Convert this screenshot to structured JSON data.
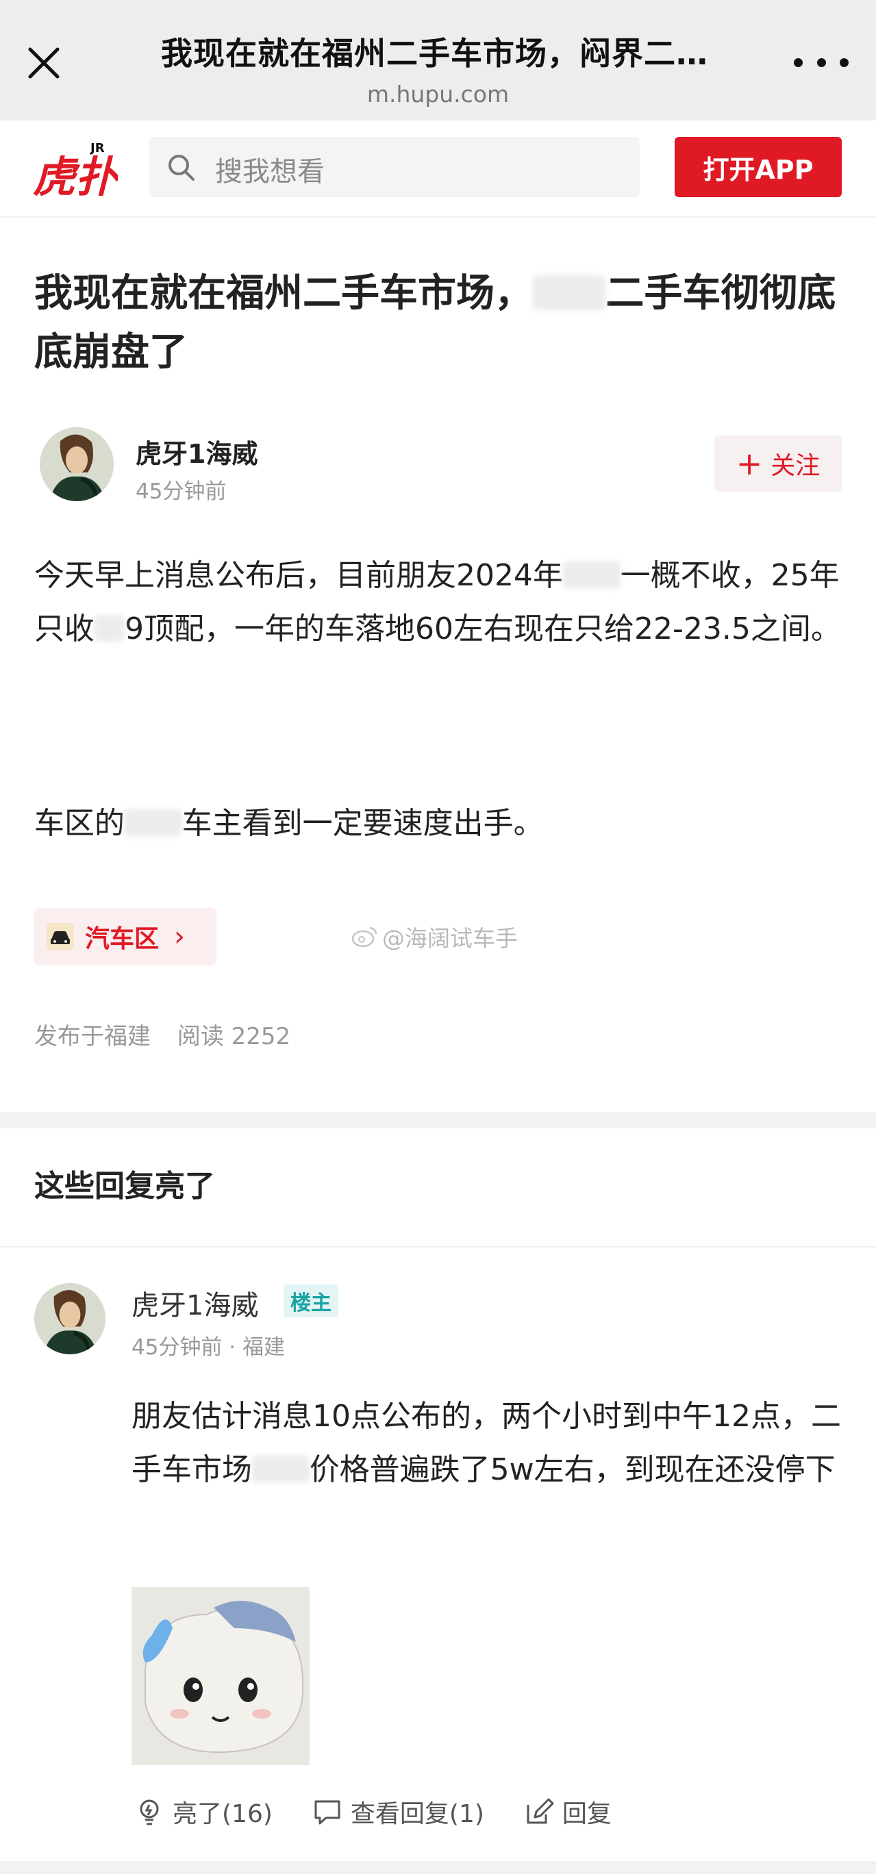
{
  "browser": {
    "title": "我现在就在福州二手车市场，闷界二…",
    "url": "m.hupu.com"
  },
  "header": {
    "logo_text": "虎扑",
    "logo_sup": "JR",
    "search_placeholder": "搜我想看",
    "open_app_label": "打开APP"
  },
  "article": {
    "title_part1": "我现在就在福州二手车市场，",
    "title_part2": "二手车彻彻底底崩盘了",
    "author": {
      "name": "虎牙1海威",
      "time": "45分钟前"
    },
    "follow_label": "关注",
    "body": {
      "p1_a": "今天早上消息公布后，目前朋友2024年",
      "p1_b": "一概不收，25年只收",
      "p1_c": "9顶配，一年的车落地60左右现在只给22-23.5之间。",
      "p2_a": "车区的",
      "p2_b": "车主看到一定要速度出手。"
    },
    "tag_label": "汽车区",
    "watermark": "@海阔试车手",
    "meta": {
      "location": "发布于福建",
      "reads": "阅读 2252"
    }
  },
  "replies_section": {
    "title": "这些回复亮了",
    "reply": {
      "name": "虎牙1海威",
      "badge": "楼主",
      "time": "45分钟前 · 福建",
      "text_a": "朋友估计消息10点公布的，两个小时到中午12点，二手车市场",
      "text_b": "价格普遍跌了5w左右，到现在还没停下",
      "actions": {
        "light": "亮了(16)",
        "view_replies": "查看回复(1)",
        "reply": "回复"
      }
    }
  },
  "colors": {
    "brand_red": "#e01a25",
    "badge_teal": "#1aa3a3",
    "muted": "#999999"
  }
}
